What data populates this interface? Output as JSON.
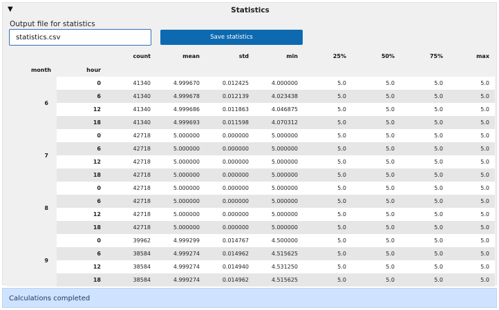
{
  "panel": {
    "title": "Statistics",
    "collapse_icon": "triangle-down-icon",
    "output_label": "Output file for statistics",
    "output_value": "statistics.csv",
    "save_label": "Save statistics"
  },
  "table": {
    "columns": [
      "count",
      "mean",
      "std",
      "min",
      "25%",
      "50%",
      "75%",
      "max"
    ],
    "index_names": [
      "month",
      "hour"
    ],
    "groups": [
      {
        "month": "6",
        "rows": [
          {
            "hour": "0",
            "values": [
              "41340",
              "4.999670",
              "0.012425",
              "4.000000",
              "5.0",
              "5.0",
              "5.0",
              "5.0"
            ]
          },
          {
            "hour": "6",
            "values": [
              "41340",
              "4.999678",
              "0.012139",
              "4.023438",
              "5.0",
              "5.0",
              "5.0",
              "5.0"
            ]
          },
          {
            "hour": "12",
            "values": [
              "41340",
              "4.999686",
              "0.011863",
              "4.046875",
              "5.0",
              "5.0",
              "5.0",
              "5.0"
            ]
          },
          {
            "hour": "18",
            "values": [
              "41340",
              "4.999693",
              "0.011598",
              "4.070312",
              "5.0",
              "5.0",
              "5.0",
              "5.0"
            ]
          }
        ]
      },
      {
        "month": "7",
        "rows": [
          {
            "hour": "0",
            "values": [
              "42718",
              "5.000000",
              "0.000000",
              "5.000000",
              "5.0",
              "5.0",
              "5.0",
              "5.0"
            ]
          },
          {
            "hour": "6",
            "values": [
              "42718",
              "5.000000",
              "0.000000",
              "5.000000",
              "5.0",
              "5.0",
              "5.0",
              "5.0"
            ]
          },
          {
            "hour": "12",
            "values": [
              "42718",
              "5.000000",
              "0.000000",
              "5.000000",
              "5.0",
              "5.0",
              "5.0",
              "5.0"
            ]
          },
          {
            "hour": "18",
            "values": [
              "42718",
              "5.000000",
              "0.000000",
              "5.000000",
              "5.0",
              "5.0",
              "5.0",
              "5.0"
            ]
          }
        ]
      },
      {
        "month": "8",
        "rows": [
          {
            "hour": "0",
            "values": [
              "42718",
              "5.000000",
              "0.000000",
              "5.000000",
              "5.0",
              "5.0",
              "5.0",
              "5.0"
            ]
          },
          {
            "hour": "6",
            "values": [
              "42718",
              "5.000000",
              "0.000000",
              "5.000000",
              "5.0",
              "5.0",
              "5.0",
              "5.0"
            ]
          },
          {
            "hour": "12",
            "values": [
              "42718",
              "5.000000",
              "0.000000",
              "5.000000",
              "5.0",
              "5.0",
              "5.0",
              "5.0"
            ]
          },
          {
            "hour": "18",
            "values": [
              "42718",
              "5.000000",
              "0.000000",
              "5.000000",
              "5.0",
              "5.0",
              "5.0",
              "5.0"
            ]
          }
        ]
      },
      {
        "month": "9",
        "rows": [
          {
            "hour": "0",
            "values": [
              "39962",
              "4.999299",
              "0.014767",
              "4.500000",
              "5.0",
              "5.0",
              "5.0",
              "5.0"
            ]
          },
          {
            "hour": "6",
            "values": [
              "38584",
              "4.999274",
              "0.014962",
              "4.515625",
              "5.0",
              "5.0",
              "5.0",
              "5.0"
            ]
          },
          {
            "hour": "12",
            "values": [
              "38584",
              "4.999274",
              "0.014940",
              "4.531250",
              "5.0",
              "5.0",
              "5.0",
              "5.0"
            ]
          },
          {
            "hour": "18",
            "values": [
              "38584",
              "4.999274",
              "0.014962",
              "4.515625",
              "5.0",
              "5.0",
              "5.0",
              "5.0"
            ]
          }
        ]
      }
    ]
  },
  "status": {
    "text": "Calculations completed"
  },
  "colors": {
    "accent": "#0e6ab0",
    "status_bg": "#cfe2ff"
  }
}
